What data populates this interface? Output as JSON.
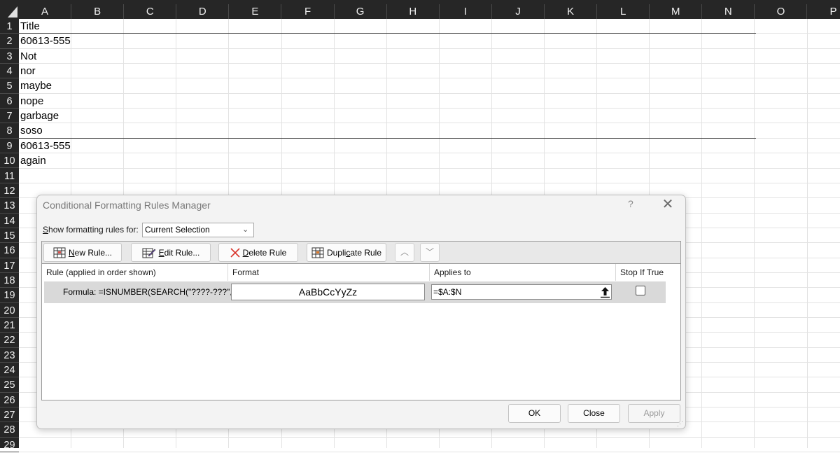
{
  "sheet": {
    "columns": [
      "A",
      "B",
      "C",
      "D",
      "E",
      "F",
      "G",
      "H",
      "I",
      "J",
      "K",
      "L",
      "M",
      "N",
      "O",
      "P"
    ],
    "rows": [
      "1",
      "2",
      "3",
      "4",
      "5",
      "6",
      "7",
      "8",
      "9",
      "10",
      "11",
      "12",
      "13",
      "14",
      "15",
      "16",
      "17",
      "18",
      "19",
      "20",
      "21",
      "22",
      "23",
      "24",
      "25",
      "26",
      "27",
      "28",
      "29"
    ],
    "cells": [
      {
        "row": 1,
        "value": "Title"
      },
      {
        "row": 2,
        "value": "60613-555"
      },
      {
        "row": 3,
        "value": "Not"
      },
      {
        "row": 4,
        "value": "nor"
      },
      {
        "row": 5,
        "value": "maybe"
      },
      {
        "row": 6,
        "value": "nope"
      },
      {
        "row": 7,
        "value": "garbage"
      },
      {
        "row": 8,
        "value": "soso"
      },
      {
        "row": 9,
        "value": "60613-555"
      },
      {
        "row": 10,
        "value": "again"
      }
    ]
  },
  "dialog": {
    "title": "Conditional Formatting Rules Manager",
    "help": "?",
    "close_glyph": "✕",
    "show_rules_label": "Show formatting rules for:",
    "show_rules_value": "Current Selection",
    "toolbar": {
      "new_rule": "New Rule...",
      "edit_rule": "Edit Rule...",
      "delete_rule": "Delete Rule",
      "duplicate_rule": "Duplicate Rule",
      "move_up": "︿",
      "move_down": "﹀"
    },
    "columns": {
      "rule": "Rule (applied in order shown)",
      "format": "Format",
      "applies_to": "Applies to",
      "stop_if_true": "Stop If True"
    },
    "rule": {
      "text": "Formula: =ISNUMBER(SEARCH(\"????-???\",$...",
      "format_preview": "AaBbCcYyZz",
      "applies_to": "=$A:$N",
      "stop_if_true": false
    },
    "buttons": {
      "ok": "OK",
      "close": "Close",
      "apply": "Apply"
    }
  }
}
